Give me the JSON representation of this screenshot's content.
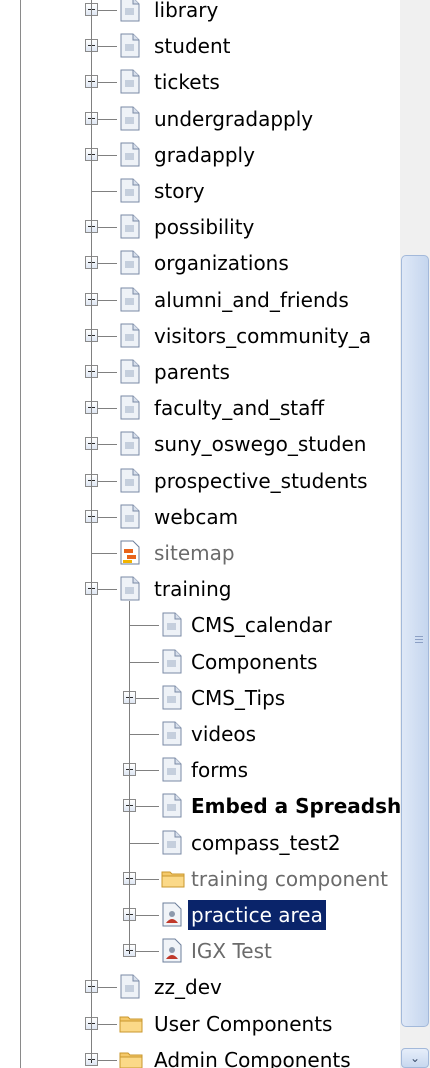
{
  "tree": {
    "top_items": [
      {
        "label": "library",
        "expander": "plus",
        "icon": "page",
        "style": "normal"
      },
      {
        "label": "student",
        "expander": "plus",
        "icon": "page",
        "style": "normal"
      },
      {
        "label": "tickets",
        "expander": "plus",
        "icon": "page",
        "style": "normal"
      },
      {
        "label": "undergradapply",
        "expander": "plus",
        "icon": "page",
        "style": "normal"
      },
      {
        "label": "gradapply",
        "expander": "plus",
        "icon": "page",
        "style": "normal"
      },
      {
        "label": "story",
        "expander": "none",
        "icon": "page",
        "style": "normal"
      },
      {
        "label": "possibility",
        "expander": "plus",
        "icon": "page",
        "style": "normal"
      },
      {
        "label": "organizations",
        "expander": "plus",
        "icon": "page",
        "style": "normal"
      },
      {
        "label": "alumni_and_friends",
        "expander": "plus",
        "icon": "page",
        "style": "normal"
      },
      {
        "label": "visitors_community_a",
        "expander": "plus",
        "icon": "page",
        "style": "normal"
      },
      {
        "label": "parents",
        "expander": "plus",
        "icon": "page",
        "style": "normal"
      },
      {
        "label": "faculty_and_staff",
        "expander": "plus",
        "icon": "page",
        "style": "normal"
      },
      {
        "label": "suny_oswego_studen",
        "expander": "plus",
        "icon": "page",
        "style": "normal"
      },
      {
        "label": "prospective_students",
        "expander": "plus",
        "icon": "page",
        "style": "normal"
      },
      {
        "label": "webcam",
        "expander": "plus",
        "icon": "page",
        "style": "normal"
      },
      {
        "label": "sitemap",
        "expander": "none",
        "icon": "sitemap",
        "style": "gray"
      },
      {
        "label": "training",
        "expander": "minus",
        "icon": "page",
        "style": "normal"
      }
    ],
    "training_children": [
      {
        "label": "CMS_calendar",
        "expander": "none",
        "icon": "page",
        "style": "normal"
      },
      {
        "label": "Components",
        "expander": "none",
        "icon": "page",
        "style": "normal"
      },
      {
        "label": "CMS_Tips",
        "expander": "plus",
        "icon": "page",
        "style": "normal"
      },
      {
        "label": "videos",
        "expander": "none",
        "icon": "page",
        "style": "normal"
      },
      {
        "label": "forms",
        "expander": "plus",
        "icon": "page",
        "style": "normal"
      },
      {
        "label": "Embed a Spreadsh",
        "expander": "plus",
        "icon": "page",
        "style": "bold"
      },
      {
        "label": "compass_test2",
        "expander": "none",
        "icon": "page",
        "style": "normal"
      },
      {
        "label": "training component",
        "expander": "plus",
        "icon": "folder",
        "style": "gray"
      },
      {
        "label": "practice area",
        "expander": "plus",
        "icon": "page-person",
        "style": "selected"
      },
      {
        "label": "IGX Test",
        "expander": "plus",
        "icon": "page-person",
        "style": "gray"
      }
    ],
    "bottom_items": [
      {
        "label": "zz_dev",
        "expander": "plus",
        "icon": "page",
        "style": "normal"
      },
      {
        "label": "User Components",
        "expander": "plus",
        "icon": "folder",
        "style": "normal"
      },
      {
        "label": "Admin Components",
        "expander": "plus",
        "icon": "folder",
        "style": "normal"
      }
    ]
  },
  "scrollbar": {
    "down_arrow": "⌄"
  },
  "colors": {
    "selected_bg": "#0a246a",
    "selected_text": "#ffffff",
    "gray_text": "#6b6b6b",
    "folder": "#f5c96a"
  }
}
